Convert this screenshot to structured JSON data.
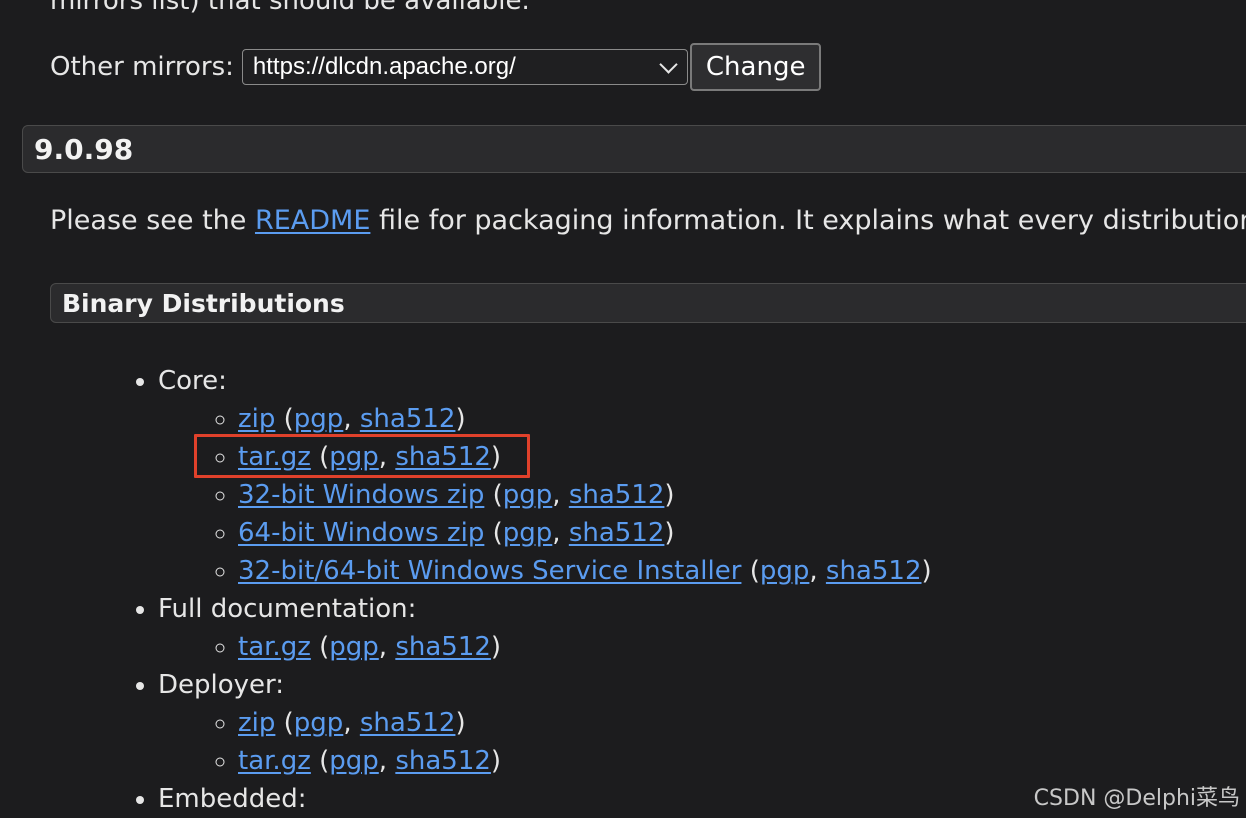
{
  "top_text_cut": "mirrors list) that should be available.",
  "mirror": {
    "label": "Other mirrors:",
    "selected": "https://dlcdn.apache.org/",
    "button": "Change"
  },
  "version": "9.0.98",
  "readme": {
    "before": "Please see the ",
    "link": "README",
    "after": " file for packaging information. It explains what every distribution contains."
  },
  "section_title": "Binary Distributions",
  "sections": [
    {
      "label": "Core:",
      "items": [
        {
          "name": "zip",
          "pgp": "pgp",
          "sha": "sha512"
        },
        {
          "name": "tar.gz",
          "pgp": "pgp",
          "sha": "sha512",
          "highlighted": true
        },
        {
          "name": "32-bit Windows zip",
          "pgp": "pgp",
          "sha": "sha512"
        },
        {
          "name": "64-bit Windows zip",
          "pgp": "pgp",
          "sha": "sha512"
        },
        {
          "name": "32-bit/64-bit Windows Service Installer",
          "pgp": "pgp",
          "sha": "sha512"
        }
      ]
    },
    {
      "label": "Full documentation:",
      "items": [
        {
          "name": "tar.gz",
          "pgp": "pgp",
          "sha": "sha512"
        }
      ]
    },
    {
      "label": "Deployer:",
      "items": [
        {
          "name": "zip",
          "pgp": "pgp",
          "sha": "sha512"
        },
        {
          "name": "tar.gz",
          "pgp": "pgp",
          "sha": "sha512"
        }
      ]
    },
    {
      "label": "Embedded:",
      "items": []
    }
  ],
  "watermark": "CSDN @Delphi菜鸟",
  "colors": {
    "background": "#1c1c1e",
    "link": "#5b9cf0",
    "highlight_box": "#e0412b"
  },
  "icons": {
    "select_arrow": "chevron-down-icon"
  }
}
